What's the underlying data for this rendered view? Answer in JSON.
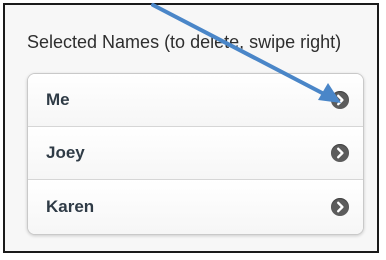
{
  "header": {
    "title": "Selected Names (to delete, swipe right)"
  },
  "names": [
    {
      "label": "Me",
      "icon": "chevron-right-circle-icon"
    },
    {
      "label": "Joey",
      "icon": "chevron-right-circle-icon"
    },
    {
      "label": "Karen",
      "icon": "chevron-right-circle-icon"
    }
  ],
  "annotation": {
    "icon": "pointer-arrow-icon",
    "color": "#4a86c8"
  },
  "colors": {
    "row_text": "#2f3b46",
    "chevron_bg": "#5c5c5c"
  }
}
